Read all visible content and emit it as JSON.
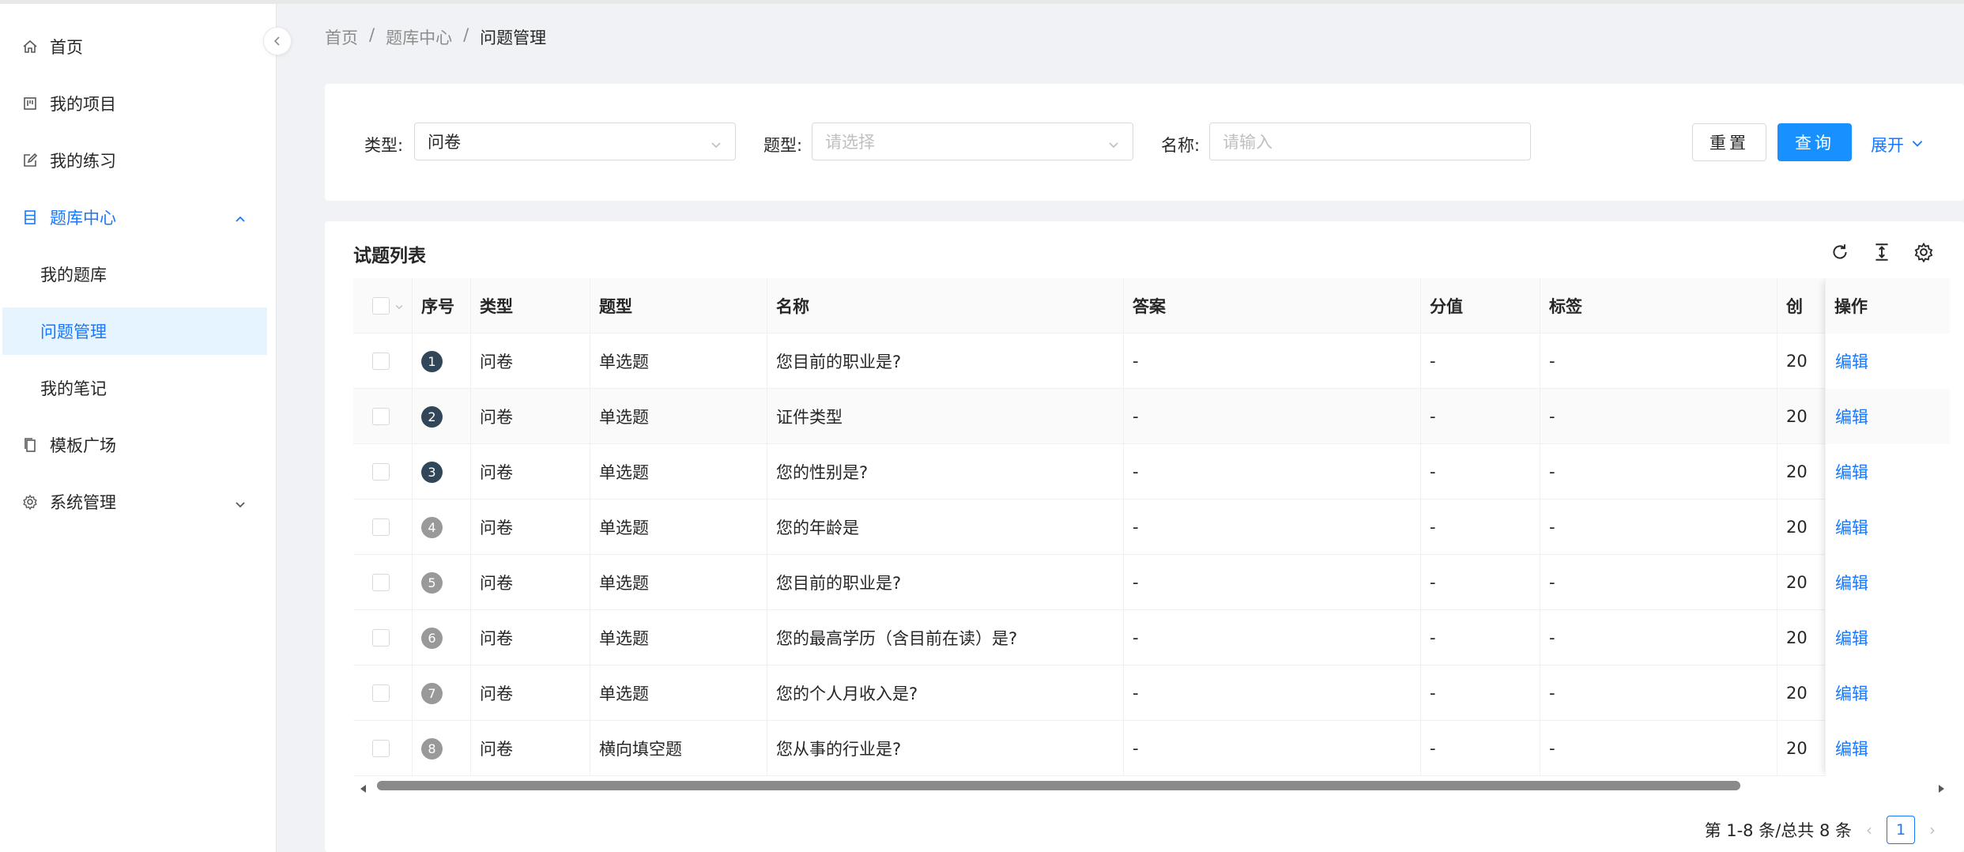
{
  "sidebar": {
    "items": [
      {
        "label": "首页",
        "icon": "home-icon"
      },
      {
        "label": "我的项目",
        "icon": "project-icon"
      },
      {
        "label": "我的练习",
        "icon": "edit-icon"
      },
      {
        "label": "题库中心",
        "icon": "database-icon"
      },
      {
        "label": "模板广场",
        "icon": "copy-icon"
      },
      {
        "label": "系统管理",
        "icon": "gear-icon"
      }
    ],
    "sub_items": [
      {
        "label": "我的题库"
      },
      {
        "label": "问题管理"
      },
      {
        "label": "我的笔记"
      }
    ],
    "active_sub": "问题管理"
  },
  "breadcrumb": {
    "items": [
      "首页",
      "题库中心",
      "问题管理"
    ],
    "separator": "/"
  },
  "filters": {
    "type_label": "类型:",
    "type_value": "问卷",
    "qtype_label": "题型:",
    "qtype_placeholder": "请选择",
    "name_label": "名称:",
    "name_placeholder": "请输入",
    "reset_label": "重置",
    "query_label": "查询",
    "expand_label": "展开"
  },
  "table": {
    "title": "试题列表",
    "columns": [
      "序号",
      "类型",
      "题型",
      "名称",
      "答案",
      "分值",
      "标签",
      "创",
      "操作"
    ],
    "rows": [
      {
        "index": "1",
        "type": "问卷",
        "qtype": "单选题",
        "name": "您目前的职业是?",
        "answer": "-",
        "score": "-",
        "tags": "-",
        "created": "20",
        "action": "编辑"
      },
      {
        "index": "2",
        "type": "问卷",
        "qtype": "单选题",
        "name": "证件类型",
        "answer": "-",
        "score": "-",
        "tags": "-",
        "created": "20",
        "action": "编辑"
      },
      {
        "index": "3",
        "type": "问卷",
        "qtype": "单选题",
        "name": "您的性别是?",
        "answer": "-",
        "score": "-",
        "tags": "-",
        "created": "20",
        "action": "编辑"
      },
      {
        "index": "4",
        "type": "问卷",
        "qtype": "单选题",
        "name": "您的年龄是",
        "answer": "-",
        "score": "-",
        "tags": "-",
        "created": "20",
        "action": "编辑"
      },
      {
        "index": "5",
        "type": "问卷",
        "qtype": "单选题",
        "name": "您目前的职业是?",
        "answer": "-",
        "score": "-",
        "tags": "-",
        "created": "20",
        "action": "编辑"
      },
      {
        "index": "6",
        "type": "问卷",
        "qtype": "单选题",
        "name": "您的最高学历（含目前在读）是?",
        "answer": "-",
        "score": "-",
        "tags": "-",
        "created": "20",
        "action": "编辑"
      },
      {
        "index": "7",
        "type": "问卷",
        "qtype": "单选题",
        "name": "您的个人月收入是?",
        "answer": "-",
        "score": "-",
        "tags": "-",
        "created": "20",
        "action": "编辑"
      },
      {
        "index": "8",
        "type": "问卷",
        "qtype": "横向填空题",
        "name": "您从事的行业是?",
        "answer": "-",
        "score": "-",
        "tags": "-",
        "created": "20",
        "action": "编辑"
      }
    ]
  },
  "pagination": {
    "summary": "第 1-8 条/总共 8 条",
    "current_page": "1"
  },
  "colors": {
    "primary": "#1677ff",
    "index_dark": "#314659",
    "index_grey": "#999999"
  }
}
